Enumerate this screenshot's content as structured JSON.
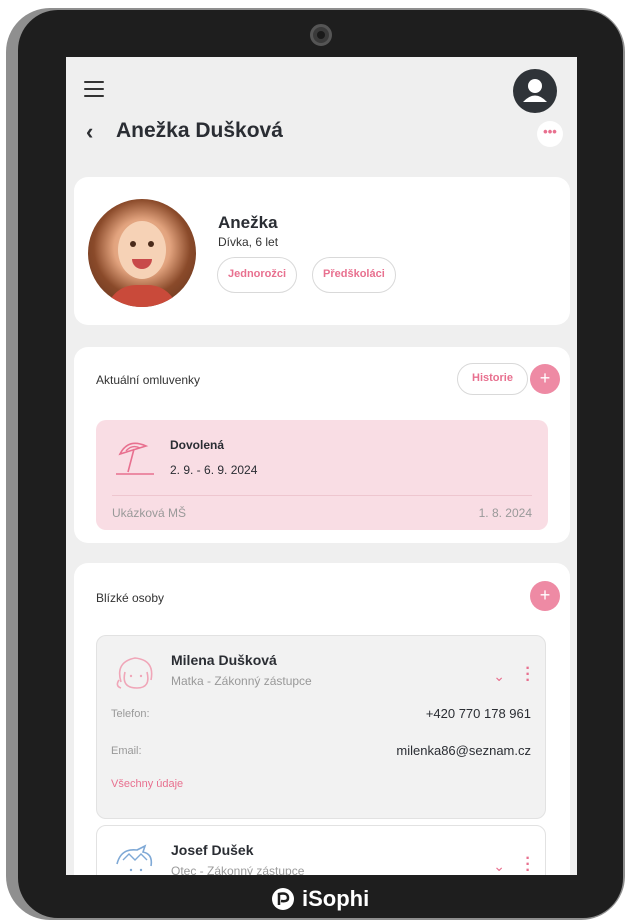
{
  "header": {
    "title": "Anežka Dušková"
  },
  "profile": {
    "name": "Anežka",
    "subtitle": "Dívka, 6 let",
    "groups": [
      "Jednorožci",
      "Předškoláci"
    ]
  },
  "absences": {
    "title": "Aktuální omluvenky",
    "history_label": "Historie",
    "add_label": "+",
    "items": [
      {
        "type": "Dovolená",
        "dates": "2. 9. - 6. 9. 2024",
        "school": "Ukázková MŠ",
        "created": "1. 8. 2024"
      }
    ]
  },
  "contacts": {
    "title": "Blízké osoby",
    "add_label": "+",
    "persons": [
      {
        "name": "Milena Dušková",
        "role": "Matka - Zákonný zástupce",
        "phone_label": "Telefon:",
        "phone": "+420 770 178 961",
        "email_label": "Email:",
        "email": "milenka86@seznam.cz",
        "all_details_label": "Všechny údaje"
      },
      {
        "name": "Josef Dušek",
        "role": "Otec - Zákonný zástupce"
      }
    ]
  },
  "brand": {
    "name": "iSophi"
  },
  "icons": {
    "menu": "hamburger-menu-icon",
    "account": "user-account-icon",
    "back": "chevron-left-icon",
    "more": "more-dots-icon",
    "umbrella": "beach-umbrella-icon",
    "chevron": "chevron-down-icon",
    "kebab": "vertical-dots-icon"
  },
  "colors": {
    "accent": "#e8708f",
    "accent_fill": "#ee8aa4",
    "absence_bg": "#f9dde4",
    "screen_bg": "#efefef"
  }
}
